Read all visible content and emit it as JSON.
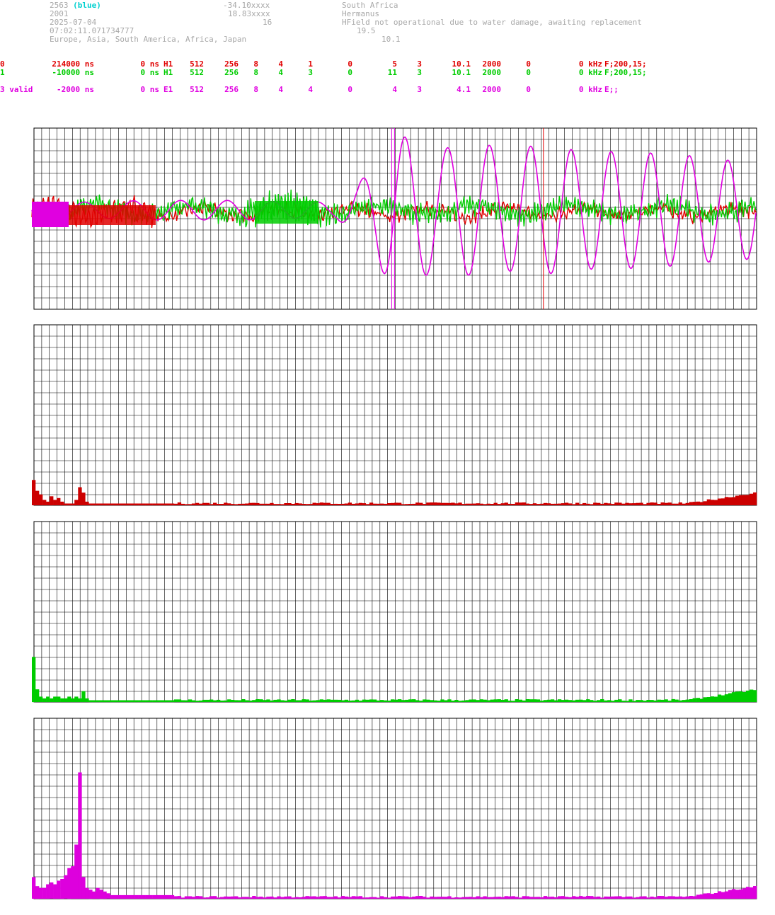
{
  "header": {
    "station_id": "2563",
    "station_color": "(blue)",
    "year": "2001",
    "date": "2025-07-04",
    "time": "07:02:11.071734777",
    "regions": "Europe, Asia, South America, Africa, Japan",
    "latitude": "-34.10xxxx",
    "longitude": "18.83xxxx",
    "altitude": "16",
    "country": "South Africa",
    "city": "Hermanus",
    "status_note": "HField not operational due to water damage, awaiting replacement",
    "value_a": "19.5",
    "value_b": "10.1"
  },
  "channels": [
    {
      "id": "0",
      "offset": "214000 ns",
      "delay": "0 ns",
      "type": "H1",
      "c1": "512",
      "c2": "256",
      "c3": "8",
      "c4": "4",
      "c5": "1",
      "c6": "0",
      "c7": "5",
      "c8": "3",
      "c9": "10.1",
      "c10": "2000",
      "c11": "0",
      "freq": "0 kHz",
      "filter": "F;200,15;",
      "color": "#e00000"
    },
    {
      "id": "1",
      "offset": "-10000 ns",
      "delay": "0 ns",
      "type": "H1",
      "c1": "512",
      "c2": "256",
      "c3": "8",
      "c4": "4",
      "c5": "3",
      "c6": "0",
      "c7": "11",
      "c8": "3",
      "c9": "10.1",
      "c10": "2000",
      "c11": "0",
      "freq": "0 kHz",
      "filter": "F;200,15;",
      "color": "#00cc00"
    },
    {
      "id": "3 valid",
      "offset": "-2000 ns",
      "delay": "0 ns",
      "type": "E1",
      "c1": "512",
      "c2": "256",
      "c3": "8",
      "c4": "4",
      "c5": "4",
      "c6": "0",
      "c7": "4",
      "c8": "3",
      "c9": "4.1",
      "c10": "2000",
      "c11": "0",
      "freq": "0 kHz",
      "filter": "E;;",
      "color": "#e000e0"
    }
  ],
  "chart_data": [
    {
      "type": "line",
      "grid": true,
      "series": [
        {
          "color": "#e000e0",
          "marker_index": 0.495,
          "envelope": [
            [
              0.0,
              0.08
            ],
            [
              0.05,
              0.1
            ],
            [
              0.1,
              0.1
            ],
            [
              0.15,
              0.12
            ],
            [
              0.2,
              0.12
            ],
            [
              0.25,
              0.12
            ],
            [
              0.3,
              0.12
            ],
            [
              0.35,
              0.1
            ],
            [
              0.38,
              0.1
            ],
            [
              0.42,
              0.1
            ],
            [
              0.45,
              0.3
            ],
            [
              0.48,
              0.7
            ],
            [
              0.5,
              0.95
            ],
            [
              0.53,
              0.85
            ],
            [
              0.56,
              0.75
            ],
            [
              0.6,
              0.8
            ],
            [
              0.63,
              0.8
            ],
            [
              0.66,
              0.75
            ],
            [
              0.7,
              0.8
            ],
            [
              0.74,
              0.75
            ],
            [
              0.78,
              0.72
            ],
            [
              0.82,
              0.72
            ],
            [
              0.86,
              0.7
            ],
            [
              0.9,
              0.68
            ],
            [
              0.95,
              0.62
            ],
            [
              1.0,
              0.6
            ]
          ],
          "cycles": 16
        },
        {
          "color": "#e00000",
          "marker_index": 0.705
        },
        {
          "color": "#00cc00"
        }
      ]
    },
    {
      "type": "bar",
      "grid": true,
      "color": "#cc0000",
      "values": [
        0.14,
        0.08,
        0.06,
        0.03,
        0.02,
        0.05,
        0.03,
        0.04,
        0.02,
        0.01,
        0.01,
        0.01,
        0.03,
        0.1,
        0.07,
        0.02,
        0.01,
        0.01,
        0.01,
        0.01,
        0.01,
        0.01,
        0.01,
        0.01,
        0.01,
        0.01,
        0.01,
        0.01,
        0.01,
        0.01,
        0.01,
        0.01,
        0.01,
        0.01,
        0.01,
        0.01,
        0.01,
        0.01,
        0.01,
        0.01
      ]
    },
    {
      "type": "bar",
      "grid": true,
      "color": "#00cc00",
      "values": [
        0.25,
        0.07,
        0.03,
        0.02,
        0.03,
        0.02,
        0.03,
        0.03,
        0.02,
        0.02,
        0.03,
        0.02,
        0.03,
        0.02,
        0.06,
        0.02,
        0.01,
        0.01,
        0.01,
        0.01,
        0.01,
        0.01,
        0.01,
        0.01,
        0.01,
        0.01,
        0.01,
        0.01,
        0.01,
        0.01,
        0.01,
        0.01,
        0.01,
        0.01,
        0.01,
        0.01,
        0.01,
        0.01,
        0.01,
        0.01
      ]
    },
    {
      "type": "bar",
      "grid": true,
      "color": "#dd00dd",
      "values": [
        0.12,
        0.07,
        0.06,
        0.06,
        0.08,
        0.09,
        0.08,
        0.1,
        0.11,
        0.13,
        0.17,
        0.18,
        0.3,
        0.7,
        0.12,
        0.06,
        0.05,
        0.04,
        0.06,
        0.05,
        0.04,
        0.03,
        0.02,
        0.02,
        0.02,
        0.02,
        0.02,
        0.02,
        0.02,
        0.02,
        0.02,
        0.02,
        0.02,
        0.02,
        0.02,
        0.02,
        0.02,
        0.02,
        0.02,
        0.02
      ]
    }
  ]
}
